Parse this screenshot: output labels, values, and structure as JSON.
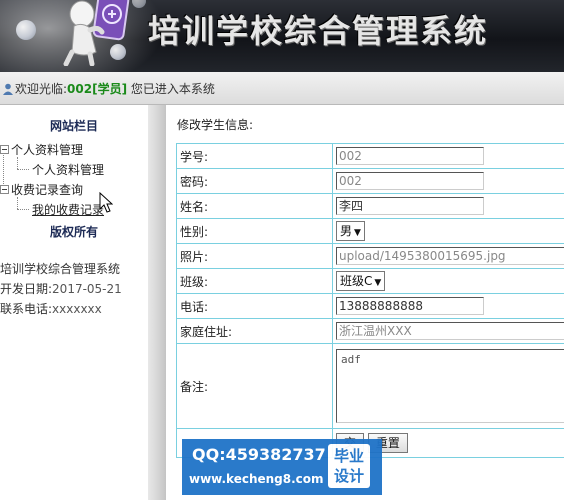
{
  "header": {
    "title": "培训学校综合管理系统"
  },
  "welcome": {
    "prefix": "欢迎光临:",
    "user": "002[学员]",
    "suffix": "您已进入本系统"
  },
  "sidebar": {
    "heading": "网站栏目",
    "groups": [
      {
        "label": "个人资料管理",
        "child": "个人资料管理"
      },
      {
        "label": "收费记录查询",
        "child": "我的收费记录"
      }
    ],
    "copyright_heading": "版权所有",
    "info": {
      "system_name": "培训学校综合管理系统",
      "dev_date_label": "开发日期:",
      "dev_date": "2017-05-21",
      "phone_label": "联系电话:",
      "phone": "xxxxxxx"
    }
  },
  "main": {
    "section_title": "修改学生信息:",
    "fields": {
      "student_no": {
        "label": "学号:",
        "value": "002"
      },
      "password": {
        "label": "密码:",
        "value": "002"
      },
      "name": {
        "label": "姓名:",
        "value": "李四"
      },
      "gender": {
        "label": "性别:",
        "value": "男"
      },
      "photo": {
        "label": "照片:",
        "value": "upload/1495380015695.jpg"
      },
      "class": {
        "label": "班级:",
        "value": "班级C"
      },
      "phone": {
        "label": "电话:",
        "value": "13888888888"
      },
      "address": {
        "label": "家庭住址:",
        "value": "浙江温州XXX"
      },
      "remark": {
        "label": "备注:",
        "value": "adf"
      }
    },
    "buttons": {
      "submit_visible": "交",
      "reset": "重置"
    }
  },
  "watermark": {
    "qq": "QQ:459382737",
    "site": "www.kecheng8.com",
    "badge_line1": "毕业",
    "badge_line2": "设计"
  }
}
